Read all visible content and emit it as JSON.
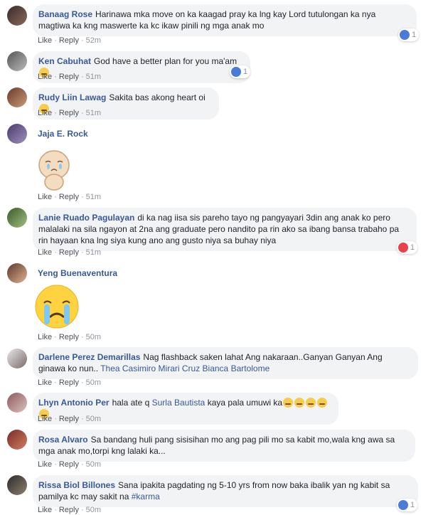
{
  "actions": {
    "like": "Like",
    "reply": "Reply"
  },
  "colors": {
    "link": "#385898",
    "bubble": "#f2f3f5",
    "meta": "#90949c",
    "like_reaction": "#4a7bd5",
    "love_reaction": "#e8434c"
  },
  "comments": [
    {
      "name": "Banaag Rose",
      "text": "Harinawa mka move on ka kaagad pray ka lng kay Lord tutulongan ka nya magtiwa ka kng maswerte ka kc ikaw pinili ng mga anak mo",
      "time": "52m",
      "reaction": {
        "icon": "like-icon",
        "count": "1"
      }
    },
    {
      "name": "Ken Cabuhat",
      "text": "God have a better plan for you ma'am",
      "emoji": "smiling-face-icon",
      "time": "51m",
      "reaction": {
        "icon": "like-icon",
        "count": "1"
      }
    },
    {
      "name": "Rudy Liin Lawag",
      "text": "Sakita bas akong heart oi",
      "emoji": "crying-face-icon",
      "time": "51m"
    },
    {
      "name": "Jaja E. Rock",
      "sticker": "sad-cat-sticker",
      "time": "51m"
    },
    {
      "name": "Lanie Ruado Pagulayan",
      "text": "di ka nag iisa sis pareho tayo ng pangyayari 3din ang anak ko pero malalaki na sila ngayon at 2na ang graduate pero nandito pa rin ako sa ibang bansa trabaho pa rin hayaan kna lng siya kung ano ang gusto niya sa buhay niya",
      "time": "51m",
      "reaction": {
        "icon": "love-icon",
        "count": "1"
      }
    },
    {
      "name": "Yeng Buenaventura",
      "sticker": "crying-emoji-sticker",
      "time": "50m"
    },
    {
      "name": "Darlene Perez Demarillas",
      "text": "Nag flashback saken lahat Ang nakaraan..Ganyan Ganyan Ang ginawa ko nun..",
      "tags": "Thea Casimiro Mirari Cruz Bianca Bartolome",
      "time": "50m"
    },
    {
      "name": "Lhyn Antonio Per",
      "text_before": "hala ate q",
      "tag": "Surla Bautista",
      "text_after": "kaya pala umuwi ka",
      "emoji": "crying-face-icon",
      "time": "50m"
    },
    {
      "name": "Rosa Alvaro",
      "text": "Sa bandang huli pang sisisihan mo ang pag pili mo sa kabit mo,wala kng awa sa mga anak mo,torpi kng lalaki ka...",
      "time": "50m"
    },
    {
      "name": "Rissa Biol Billones",
      "text": "Sana ipakita pagdating ng 5-10 yrs from now baka ibalik yan ng kabit sa pamilya kc may sakit na",
      "hashtag": "#karma",
      "time": "50m",
      "reaction": {
        "icon": "like-icon",
        "count": "1"
      }
    }
  ]
}
